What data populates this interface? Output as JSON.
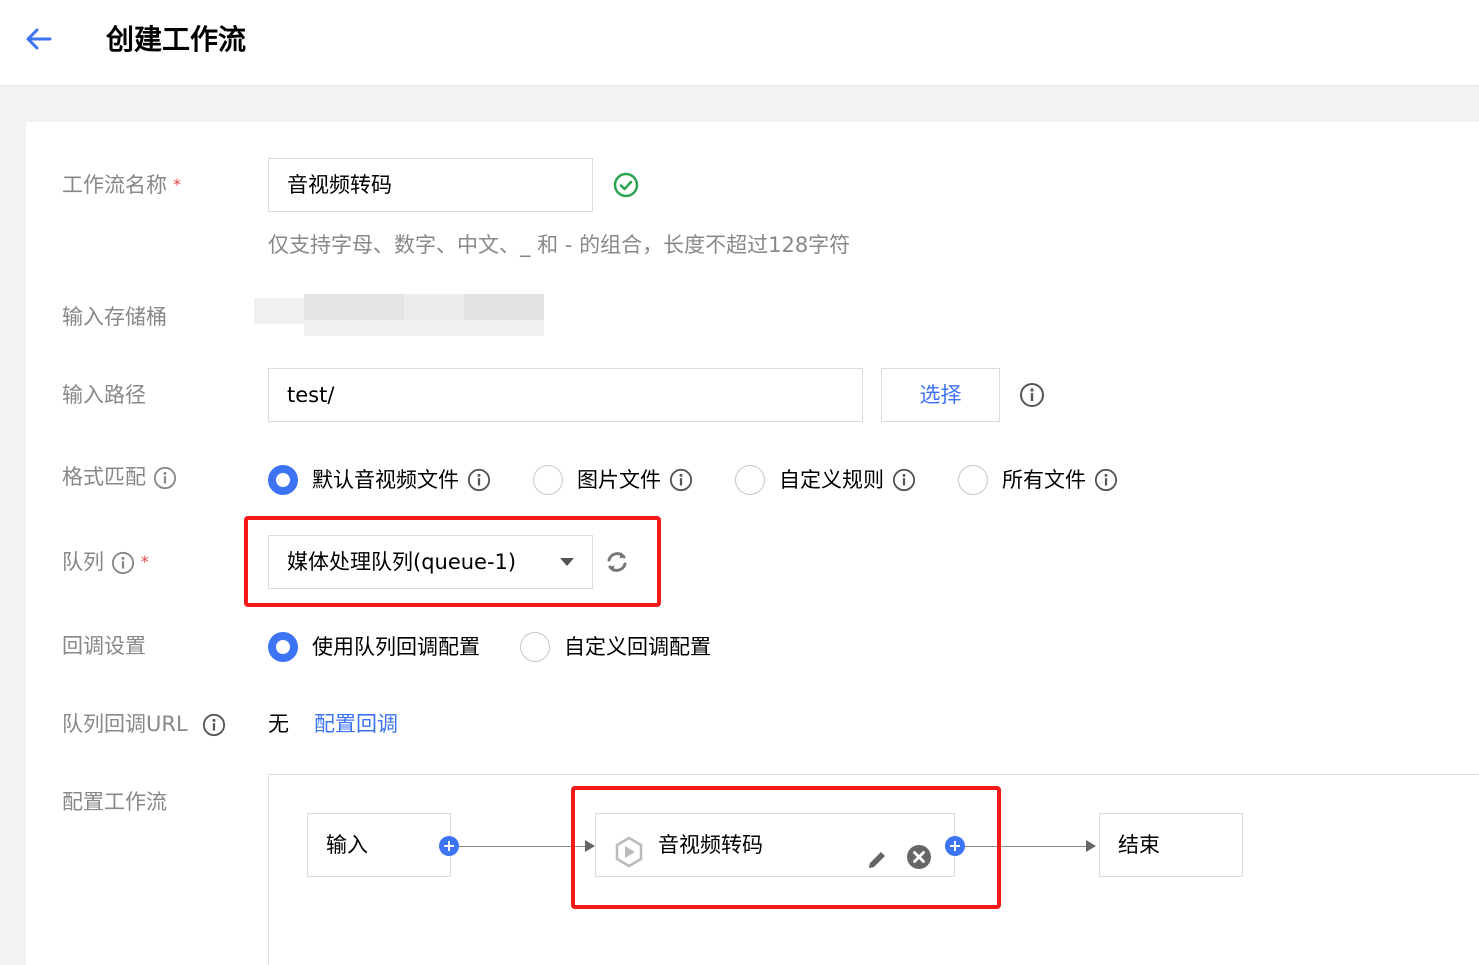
{
  "header": {
    "title": "创建工作流"
  },
  "form": {
    "workflow_name": {
      "label": "工作流名称",
      "required_mark": "*",
      "value": "音视频转码",
      "hint": "仅支持字母、数字、中文、_ 和 - 的组合，长度不超过128字符"
    },
    "input_bucket": {
      "label": "输入存储桶"
    },
    "input_path": {
      "label": "输入路径",
      "value": "test/",
      "select_button": "选择"
    },
    "format_match": {
      "label": "格式匹配",
      "options": [
        {
          "label": "默认音视频文件",
          "selected": true
        },
        {
          "label": "图片文件",
          "selected": false
        },
        {
          "label": "自定义规则",
          "selected": false
        },
        {
          "label": "所有文件",
          "selected": false
        }
      ]
    },
    "queue": {
      "label": "队列",
      "required_mark": "*",
      "selected": "媒体处理队列(queue-1)"
    },
    "callback": {
      "label": "回调设置",
      "options": [
        {
          "label": "使用队列回调配置",
          "selected": true
        },
        {
          "label": "自定义回调配置",
          "selected": false
        }
      ]
    },
    "queue_callback_url": {
      "label": "队列回调URL",
      "value": "无",
      "link": "配置回调"
    },
    "workflow_config": {
      "label": "配置工作流",
      "nodes": [
        {
          "label": "输入"
        },
        {
          "label": "音视频转码"
        },
        {
          "label": "结束"
        }
      ]
    }
  },
  "colors": {
    "accent": "#3d73f5",
    "success": "#2ea44f",
    "highlight": "#f41a1a"
  }
}
